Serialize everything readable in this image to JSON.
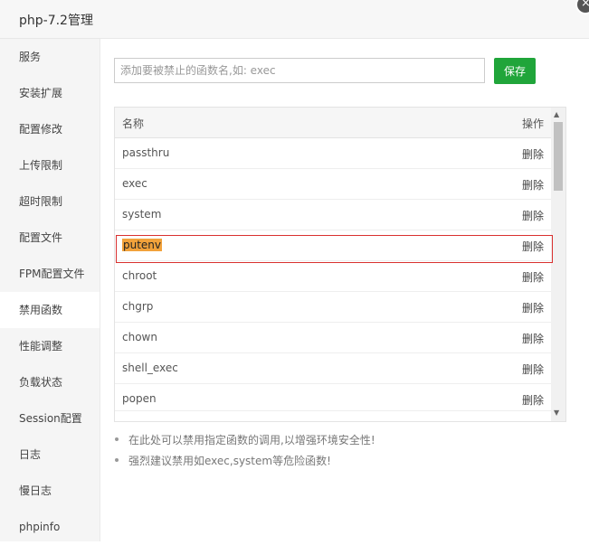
{
  "window": {
    "title": "php-7.2管理"
  },
  "sidebar": {
    "items": [
      {
        "label": "服务"
      },
      {
        "label": "安装扩展"
      },
      {
        "label": "配置修改"
      },
      {
        "label": "上传限制"
      },
      {
        "label": "超时限制"
      },
      {
        "label": "配置文件"
      },
      {
        "label": "FPM配置文件"
      },
      {
        "label": "禁用函数",
        "active": true
      },
      {
        "label": "性能调整"
      },
      {
        "label": "负载状态"
      },
      {
        "label": "Session配置"
      },
      {
        "label": "日志"
      },
      {
        "label": "慢日志"
      },
      {
        "label": "phpinfo"
      }
    ]
  },
  "search": {
    "placeholder": "添加要被禁止的函数名,如: exec",
    "value": ""
  },
  "save_label": "保存",
  "table": {
    "headers": {
      "name": "名称",
      "action": "操作"
    },
    "rows": [
      {
        "name": "passthru",
        "action": "删除"
      },
      {
        "name": "exec",
        "action": "删除"
      },
      {
        "name": "system",
        "action": "删除"
      },
      {
        "name": "putenv",
        "action": "删除",
        "highlighted": true
      },
      {
        "name": "chroot",
        "action": "删除"
      },
      {
        "name": "chgrp",
        "action": "删除"
      },
      {
        "name": "chown",
        "action": "删除"
      },
      {
        "name": "shell_exec",
        "action": "删除"
      },
      {
        "name": "popen",
        "action": "删除"
      }
    ]
  },
  "tips": [
    "在此处可以禁用指定函数的调用,以增强环境安全性!",
    "强烈建议禁用如exec,system等危险函数!"
  ],
  "colors": {
    "accent": "#20a53a",
    "highlight": "#f2a23b",
    "selection_border": "#d9312f"
  },
  "icons": {
    "close": "close-icon",
    "scroll_up": "arrow-up-icon",
    "scroll_down": "arrow-down-icon"
  }
}
